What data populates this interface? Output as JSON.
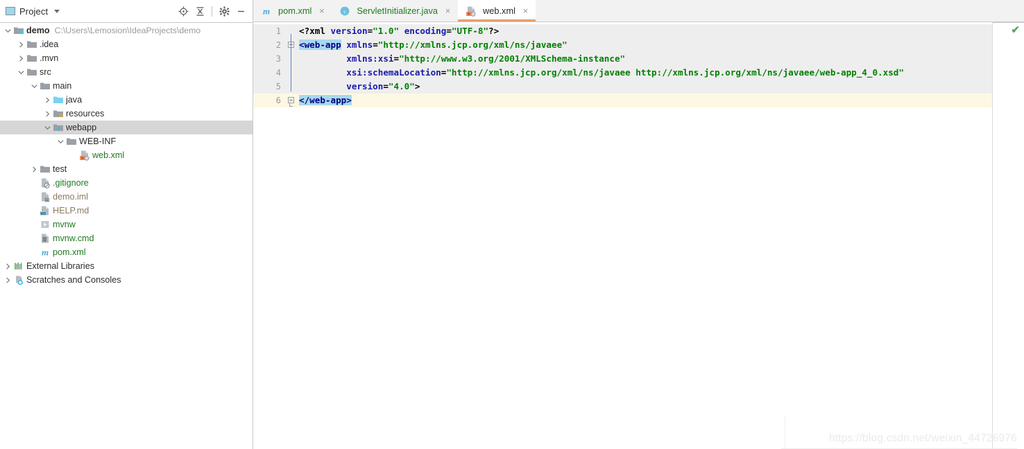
{
  "project_panel": {
    "title": "Project",
    "icon": "project-panel-icon",
    "dropdown_icon": "chevron-down-icon",
    "tools": [
      {
        "name": "locate-icon",
        "title": "Select Opened File"
      },
      {
        "name": "collapse-all-icon",
        "title": "Collapse All"
      },
      {
        "name": "gear-icon",
        "title": "Settings"
      },
      {
        "name": "minimize-icon",
        "title": "Hide"
      }
    ],
    "tree": [
      {
        "label": "demo",
        "sublabel": "C:\\Users\\Lemosion\\IdeaProjects\\demo",
        "indent": 0,
        "arrow": "expanded",
        "icon": "module-folder-icon",
        "bold": true,
        "color": "#2b2b2b",
        "selected": false
      },
      {
        "label": ".idea",
        "sublabel": "",
        "indent": 1,
        "arrow": "collapsed",
        "icon": "folder-icon",
        "bold": false,
        "color": "#2b2b2b",
        "selected": false
      },
      {
        "label": ".mvn",
        "sublabel": "",
        "indent": 1,
        "arrow": "collapsed",
        "icon": "folder-icon",
        "bold": false,
        "color": "#2b2b2b",
        "selected": false
      },
      {
        "label": "src",
        "sublabel": "",
        "indent": 1,
        "arrow": "expanded",
        "icon": "folder-icon",
        "bold": false,
        "color": "#2b2b2b",
        "selected": false
      },
      {
        "label": "main",
        "sublabel": "",
        "indent": 2,
        "arrow": "expanded",
        "icon": "folder-icon",
        "bold": false,
        "color": "#2b2b2b",
        "selected": false
      },
      {
        "label": "java",
        "sublabel": "",
        "indent": 3,
        "arrow": "collapsed",
        "icon": "source-root-folder-icon",
        "bold": false,
        "color": "#2b2b2b",
        "selected": false
      },
      {
        "label": "resources",
        "sublabel": "",
        "indent": 3,
        "arrow": "collapsed",
        "icon": "resource-root-folder-icon",
        "bold": false,
        "color": "#2b2b2b",
        "selected": false
      },
      {
        "label": "webapp",
        "sublabel": "",
        "indent": 3,
        "arrow": "expanded",
        "icon": "web-root-folder-icon",
        "bold": false,
        "color": "#2b2b2b",
        "selected": true
      },
      {
        "label": "WEB-INF",
        "sublabel": "",
        "indent": 4,
        "arrow": "expanded",
        "icon": "folder-icon",
        "bold": false,
        "color": "#2b2b2b",
        "selected": false
      },
      {
        "label": "web.xml",
        "sublabel": "",
        "indent": 5,
        "arrow": "none",
        "icon": "web-xml-file-icon",
        "bold": false,
        "color": "#1f7a1f",
        "selected": false
      },
      {
        "label": "test",
        "sublabel": "",
        "indent": 2,
        "arrow": "collapsed",
        "icon": "folder-icon",
        "bold": false,
        "color": "#2b2b2b",
        "selected": false
      },
      {
        "label": ".gitignore",
        "sublabel": "",
        "indent": 2,
        "arrow": "none",
        "icon": "gitignore-file-icon",
        "bold": false,
        "color": "#1f7a1f",
        "selected": false
      },
      {
        "label": "demo.iml",
        "sublabel": "",
        "indent": 2,
        "arrow": "none",
        "icon": "iml-file-icon",
        "bold": false,
        "color": "#8a7b5e",
        "selected": false
      },
      {
        "label": "HELP.md",
        "sublabel": "",
        "indent": 2,
        "arrow": "none",
        "icon": "markdown-file-icon",
        "bold": false,
        "color": "#8a7b5e",
        "selected": false
      },
      {
        "label": "mvnw",
        "sublabel": "",
        "indent": 2,
        "arrow": "none",
        "icon": "script-file-icon",
        "bold": false,
        "color": "#1f7a1f",
        "selected": false
      },
      {
        "label": "mvnw.cmd",
        "sublabel": "",
        "indent": 2,
        "arrow": "none",
        "icon": "cmd-file-icon",
        "bold": false,
        "color": "#1f7a1f",
        "selected": false
      },
      {
        "label": "pom.xml",
        "sublabel": "",
        "indent": 2,
        "arrow": "none",
        "icon": "maven-file-icon",
        "bold": false,
        "color": "#1f7a1f",
        "selected": false
      },
      {
        "label": "External Libraries",
        "sublabel": "",
        "indent": 0,
        "arrow": "collapsed",
        "icon": "libraries-icon",
        "bold": false,
        "color": "#2b2b2b",
        "selected": false
      },
      {
        "label": "Scratches and Consoles",
        "sublabel": "",
        "indent": 0,
        "arrow": "collapsed",
        "icon": "scratches-icon",
        "bold": false,
        "color": "#2b2b2b",
        "selected": false
      }
    ]
  },
  "editor": {
    "tabs": [
      {
        "label": "pom.xml",
        "icon": "maven-file-icon",
        "color": "#1f7a1f",
        "active": false,
        "close_glyph": "×"
      },
      {
        "label": "ServletInitializer.java",
        "icon": "java-class-icon",
        "color": "#1f7a1f",
        "active": false,
        "close_glyph": "×"
      },
      {
        "label": "web.xml",
        "icon": "web-xml-file-icon",
        "color": "#2b2b2b",
        "active": true,
        "close_glyph": "×"
      }
    ],
    "line_numbers": [
      "1",
      "2",
      "3",
      "4",
      "5",
      "6"
    ],
    "lines": [
      {
        "n": "1",
        "background": "gray",
        "tokens": [
          {
            "t": "<?xml ",
            "c": "tagmark"
          },
          {
            "t": "version",
            "c": "attr"
          },
          {
            "t": "=",
            "c": "tagmark"
          },
          {
            "t": "\"1.0\"",
            "c": "val"
          },
          {
            "t": " ",
            "c": "plain"
          },
          {
            "t": "encoding",
            "c": "attr"
          },
          {
            "t": "=",
            "c": "tagmark"
          },
          {
            "t": "\"UTF-8\"",
            "c": "val"
          },
          {
            "t": "?>",
            "c": "tagmark"
          }
        ]
      },
      {
        "n": "2",
        "background": "gray",
        "tokens": [
          {
            "t": "<web-app",
            "c": "tagname brace-hl"
          },
          {
            "t": " ",
            "c": "plain"
          },
          {
            "t": "xmlns",
            "c": "attr"
          },
          {
            "t": "=",
            "c": "tagmark"
          },
          {
            "t": "\"http://xmlns.jcp.org/xml/ns/javaee\"",
            "c": "val"
          }
        ]
      },
      {
        "n": "3",
        "background": "gray",
        "tokens": [
          {
            "t": "         ",
            "c": "plain"
          },
          {
            "t": "xmlns:xsi",
            "c": "attr"
          },
          {
            "t": "=",
            "c": "tagmark"
          },
          {
            "t": "\"http://www.w3.org/2001/XMLSchema-instance\"",
            "c": "val"
          }
        ]
      },
      {
        "n": "4",
        "background": "gray",
        "tokens": [
          {
            "t": "         ",
            "c": "plain"
          },
          {
            "t": "xsi:schemaLocation",
            "c": "attr"
          },
          {
            "t": "=",
            "c": "tagmark"
          },
          {
            "t": "\"http://xmlns.jcp.org/xml/ns/javaee http://xmlns.jcp.org/xml/ns/javaee/web-app_4_0.xsd\"",
            "c": "val"
          }
        ]
      },
      {
        "n": "5",
        "background": "gray",
        "tokens": [
          {
            "t": "         ",
            "c": "plain"
          },
          {
            "t": "version",
            "c": "attr"
          },
          {
            "t": "=",
            "c": "tagmark"
          },
          {
            "t": "\"4.0\"",
            "c": "val"
          },
          {
            "t": ">",
            "c": "tagmark"
          }
        ]
      },
      {
        "n": "6",
        "background": "hl",
        "tokens": [
          {
            "t": "</web-app>",
            "c": "tagname brace-hl"
          }
        ]
      }
    ],
    "inspection_status": "✔",
    "inspection_status_name": "inspection-ok-checkmark"
  },
  "watermark": {
    "text": "https://blog.csdn.net/weixin_44726976"
  },
  "colors": {
    "selection": "#d6d6d6",
    "caret_line": "#fdf8e3",
    "code_block_bg": "#eeeeee",
    "brace_highlight": "#a8d8f0",
    "tag_name": "#000080",
    "attribute_name": "#1a1aaa",
    "attribute_value": "#008000",
    "active_tab_underline": "#e3a06b",
    "inspection_ok": "#59a869"
  }
}
